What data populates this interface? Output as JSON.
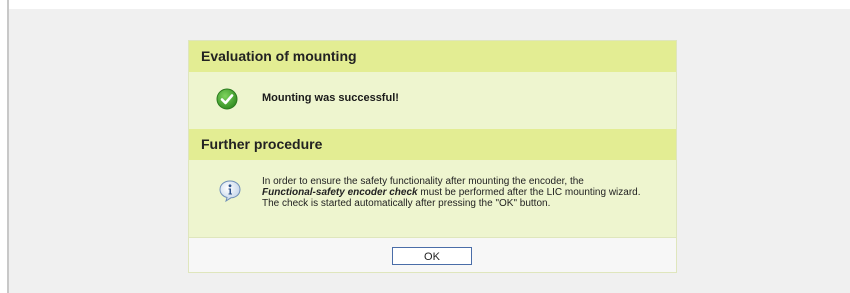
{
  "dialog": {
    "evaluation_header": "Evaluation of mounting",
    "success_icon": "check-circle-icon",
    "success_message": "Mounting was successful!",
    "procedure_header": "Further procedure",
    "info_icon": "info-bubble-icon",
    "info_text_part1": "In order to ensure the safety functionality after mounting the encoder, the",
    "info_text_bold": "Functional-safety encoder check",
    "info_text_part2": "must be performed after the LIC mounting wizard.",
    "info_text_part3": "The check is started automatically after pressing the \"OK\" button.",
    "ok_label": "OK"
  },
  "colors": {
    "header_bg": "#e3ed93",
    "body_bg": "#eef5cf",
    "success_green": "#3a9a2a",
    "button_border": "#4a6da8"
  }
}
